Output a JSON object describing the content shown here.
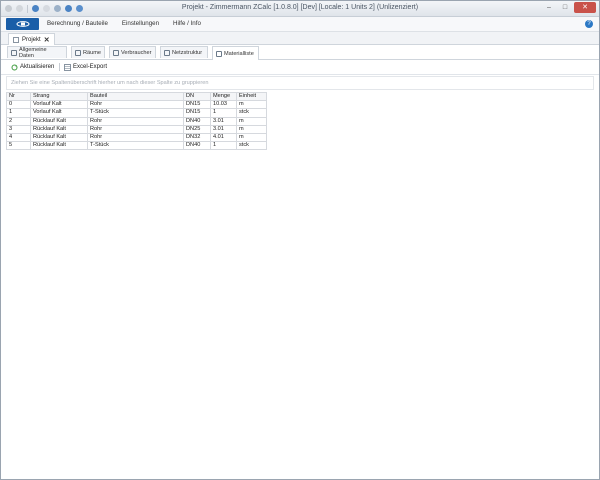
{
  "window": {
    "title": "Projekt - Zimmermann ZCalc [1.0.8.0] [Dev] [Locale: 1 Units 2] (Unlizenziert)",
    "controls": [
      "–",
      "□",
      "✕"
    ]
  },
  "quick_access": {
    "icons": [
      "save-icon",
      "undo-icon",
      "user-icon",
      "folder-icon",
      "export-icon",
      "refresh-icon",
      "settings-icon"
    ]
  },
  "menu": {
    "items": [
      "Berechnung / Bauteile",
      "Einstellungen",
      "Hilfe / Info"
    ],
    "help": "?"
  },
  "document_tab": {
    "label": "Projekt",
    "close": "✕"
  },
  "ribbon_tabs": [
    {
      "label": "Allgemeine Daten",
      "icon": "sheet-icon"
    },
    {
      "label": "Räume",
      "icon": "rooms-icon"
    },
    {
      "label": "Verbraucher",
      "icon": "consumer-icon"
    },
    {
      "label": "Netzstruktur",
      "icon": "network-icon"
    },
    {
      "label": "Materialliste",
      "icon": "list-icon"
    }
  ],
  "active_tab": "Materialliste",
  "toolbar": {
    "refresh_label": "Aktualisieren",
    "export_label": "Excel-Export"
  },
  "group_panel": {
    "hint": "Ziehen Sie eine Spaltenüberschrift hierher um nach dieser Spalte zu gruppieren"
  },
  "table": {
    "headers": [
      "Nr",
      "Strang",
      "Bauteil",
      "DN",
      "Menge",
      "Einheit"
    ],
    "rows": [
      [
        "0",
        "Vorlauf Kalt",
        "Rohr",
        "DN15",
        "10.03",
        "m"
      ],
      [
        "1",
        "Vorlauf Kalt",
        "T-Stück",
        "DN15",
        "1",
        "stck"
      ],
      [
        "2",
        "Rücklauf Kalt",
        "Rohr",
        "DN40",
        "3.01",
        "m"
      ],
      [
        "3",
        "Rücklauf Kalt",
        "Rohr",
        "DN25",
        "3.01",
        "m"
      ],
      [
        "4",
        "Rücklauf Kalt",
        "Rohr",
        "DN32",
        "4.01",
        "m"
      ],
      [
        "5",
        "Rücklauf Kalt",
        "T-Stück",
        "DN40",
        "1",
        "stck"
      ]
    ]
  },
  "colors": {
    "accent": "#1a5ea8",
    "close": "#c9524a",
    "grid_border": "#d6d9de"
  }
}
